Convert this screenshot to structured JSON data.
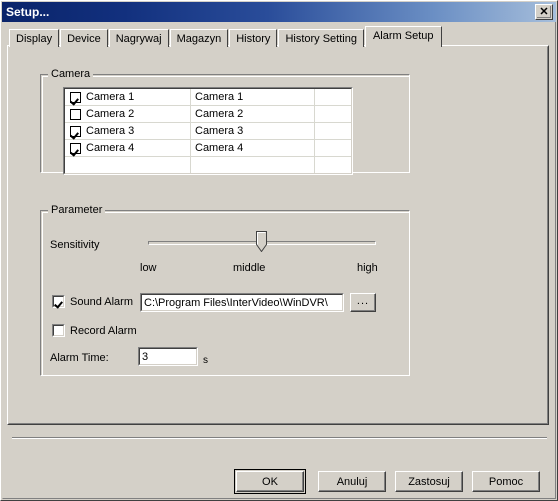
{
  "window": {
    "title": "Setup...",
    "close_label": "✕",
    "close_icon": "close-icon"
  },
  "tabs": [
    {
      "label": "Display",
      "selected": false
    },
    {
      "label": "Device",
      "selected": false
    },
    {
      "label": "Nagrywaj",
      "selected": false
    },
    {
      "label": "Magazyn",
      "selected": false
    },
    {
      "label": "History",
      "selected": false
    },
    {
      "label": "History Setting",
      "selected": false
    },
    {
      "label": "Alarm Setup",
      "selected": true
    }
  ],
  "camera_group": {
    "legend": "Camera",
    "rows": [
      {
        "checked": true,
        "name": "Camera 1",
        "title": "Camera 1",
        "extra": ""
      },
      {
        "checked": false,
        "name": "Camera 2",
        "title": "Camera 2",
        "extra": ""
      },
      {
        "checked": true,
        "name": "Camera 3",
        "title": "Camera 3",
        "extra": ""
      },
      {
        "checked": true,
        "name": "Camera 4",
        "title": "Camera 4",
        "extra": ""
      },
      {
        "checked": null,
        "name": "",
        "title": "",
        "extra": ""
      }
    ]
  },
  "parameter_group": {
    "legend": "Parameter",
    "sensitivity": {
      "label": "Sensitivity",
      "value": 50,
      "min": 0,
      "max": 100,
      "tick_low": "low",
      "tick_middle": "middle",
      "tick_high": "high"
    },
    "sound_alarm": {
      "label": "Sound Alarm",
      "checked": true,
      "path_value": "C:\\Program Files\\InterVideo\\WinDVR\\",
      "browse_label": "..."
    },
    "record_alarm": {
      "label": "Record Alarm",
      "checked": false
    },
    "alarm_time": {
      "label": "Alarm Time:",
      "value": "3",
      "unit": "s"
    }
  },
  "buttons": {
    "ok": "OK",
    "cancel": "Anuluj",
    "apply": "Zastosuj",
    "help": "Pomoc"
  },
  "colors": {
    "face": "#d4d0c8",
    "title_start": "#0a246a",
    "title_end": "#a6bedb",
    "text": "#000000",
    "field_bg": "#ffffff"
  }
}
